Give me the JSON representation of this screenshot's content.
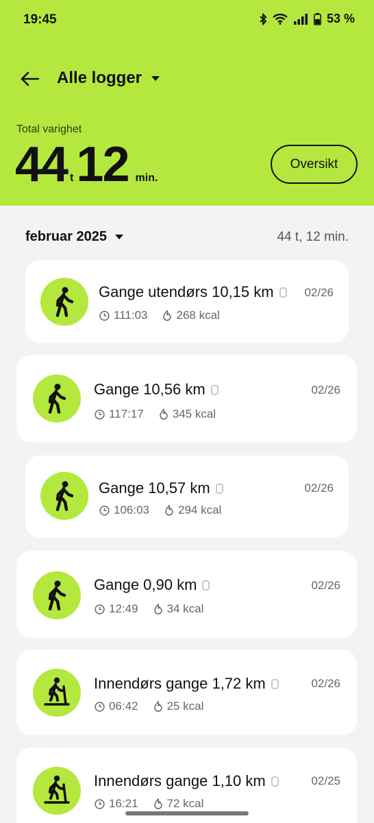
{
  "status": {
    "time": "19:45",
    "battery": "53 %"
  },
  "header": {
    "title": "Alle logger",
    "total_label": "Total varighet",
    "total_hours": "44",
    "hours_unit": "t",
    "total_minutes": "12",
    "minutes_unit": "min.",
    "overview_label": "Oversikt"
  },
  "month": {
    "label": "februar 2025",
    "total": "44 t, 12 min."
  },
  "activities": [
    {
      "title": "Gange utendørs 10,15 km",
      "date": "02/26",
      "duration": "111:03",
      "calories": "268 kcal",
      "icon": "walking-icon"
    },
    {
      "title": "Gange 10,56 km",
      "date": "02/26",
      "duration": "117:17",
      "calories": "345 kcal",
      "icon": "walking-icon"
    },
    {
      "title": "Gange 10,57 km",
      "date": "02/26",
      "duration": "106:03",
      "calories": "294 kcal",
      "icon": "walking-icon"
    },
    {
      "title": "Gange 0,90 km",
      "date": "02/26",
      "duration": "12:49",
      "calories": "34 kcal",
      "icon": "walking-icon"
    },
    {
      "title": "Innendørs gange 1,72 km",
      "date": "02/26",
      "duration": "06:42",
      "calories": "25 kcal",
      "icon": "treadmill-icon"
    },
    {
      "title": "Innendørs gange 1,10 km",
      "date": "02/25",
      "duration": "16:21",
      "calories": "72 kcal",
      "icon": "treadmill-icon"
    }
  ],
  "colors": {
    "accent": "#b4e83e",
    "background": "#f2f3f5",
    "card": "#ffffff"
  }
}
